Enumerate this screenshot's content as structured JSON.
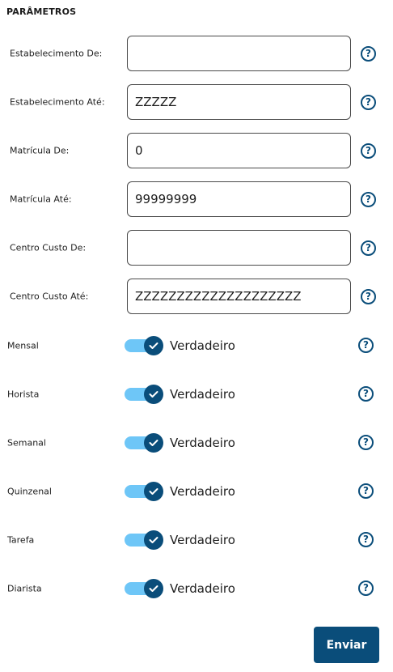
{
  "section_title": "PARÂMETROS",
  "fields": [
    {
      "label": "Estabelecimento De:",
      "value": ""
    },
    {
      "label": "Estabelecimento Até:",
      "value": "ZZZZZ"
    },
    {
      "label": "Matrícula De:",
      "value": "0"
    },
    {
      "label": "Matrícula Até:",
      "value": "99999999"
    },
    {
      "label": "Centro Custo De:",
      "value": ""
    },
    {
      "label": "Centro Custo Até:",
      "value": "ZZZZZZZZZZZZZZZZZZZZ"
    }
  ],
  "switches": [
    {
      "label": "Mensal",
      "value": "Verdadeiro",
      "checked": true
    },
    {
      "label": "Horista",
      "value": "Verdadeiro",
      "checked": true
    },
    {
      "label": "Semanal",
      "value": "Verdadeiro",
      "checked": true
    },
    {
      "label": "Quinzenal",
      "value": "Verdadeiro",
      "checked": true
    },
    {
      "label": "Tarefa",
      "value": "Verdadeiro",
      "checked": true
    },
    {
      "label": "Diarista",
      "value": "Verdadeiro",
      "checked": true
    }
  ],
  "help_icon": "question-circle-icon",
  "submit_label": "Enviar",
  "colors": {
    "primary": "#0a4d7a",
    "switch_track": "#6ec6f7",
    "input_border": "#4a4a4a"
  }
}
